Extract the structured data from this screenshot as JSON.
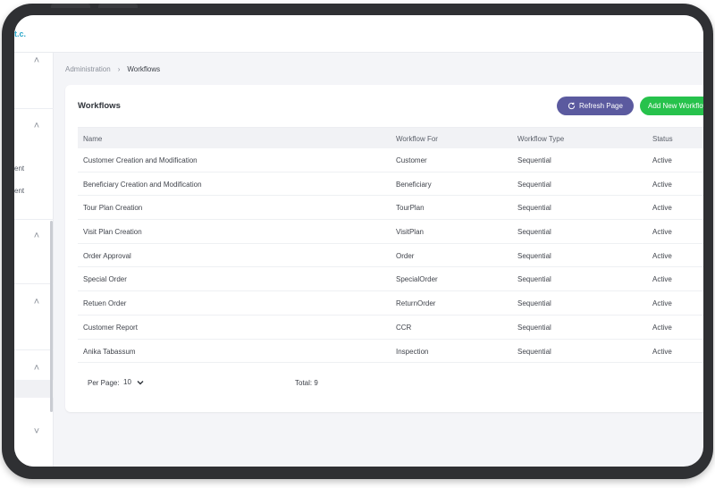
{
  "brand": {
    "fragment": "t.c."
  },
  "breadcrumb": {
    "items": [
      "Administration",
      "Workflows"
    ],
    "separator": "›"
  },
  "sidebar": {
    "text_fragments": [
      "ent",
      "ent"
    ]
  },
  "card": {
    "title": "Workflows",
    "refresh_label": "Refresh Page",
    "add_label": "Add New Workflow"
  },
  "table": {
    "columns": [
      "Name",
      "Workflow For",
      "Workflow Type",
      "Status"
    ],
    "rows": [
      {
        "name": "Customer Creation and Modification",
        "for": "Customer",
        "type": "Sequential",
        "status": "Active"
      },
      {
        "name": "Beneficiary Creation and Modification",
        "for": "Beneficiary",
        "type": "Sequential",
        "status": "Active"
      },
      {
        "name": "Tour Plan Creation",
        "for": "TourPlan",
        "type": "Sequential",
        "status": "Active"
      },
      {
        "name": "Visit Plan Creation",
        "for": "VisitPlan",
        "type": "Sequential",
        "status": "Active"
      },
      {
        "name": "Order Approval",
        "for": "Order",
        "type": "Sequential",
        "status": "Active"
      },
      {
        "name": "Special Order",
        "for": "SpecialOrder",
        "type": "Sequential",
        "status": "Active"
      },
      {
        "name": "Retuen Order",
        "for": "ReturnOrder",
        "type": "Sequential",
        "status": "Active"
      },
      {
        "name": "Customer Report",
        "for": "CCR",
        "type": "Sequential",
        "status": "Active"
      },
      {
        "name": "Anika Tabassum",
        "for": "Inspection",
        "type": "Sequential",
        "status": "Active"
      }
    ]
  },
  "footer": {
    "per_page_label": "Per Page:",
    "per_page_value": "10",
    "total_label": "Total: 9"
  },
  "colors": {
    "refresh_button": "#5b5a9f",
    "add_button": "#27c24c",
    "brand": "#2aa7c9",
    "frame": "#2f3033"
  },
  "icons": {
    "refresh": "refresh-icon",
    "sidebar_chevrons": "chevron-up-icon",
    "per_page_chevron": "chevron-down-icon"
  }
}
